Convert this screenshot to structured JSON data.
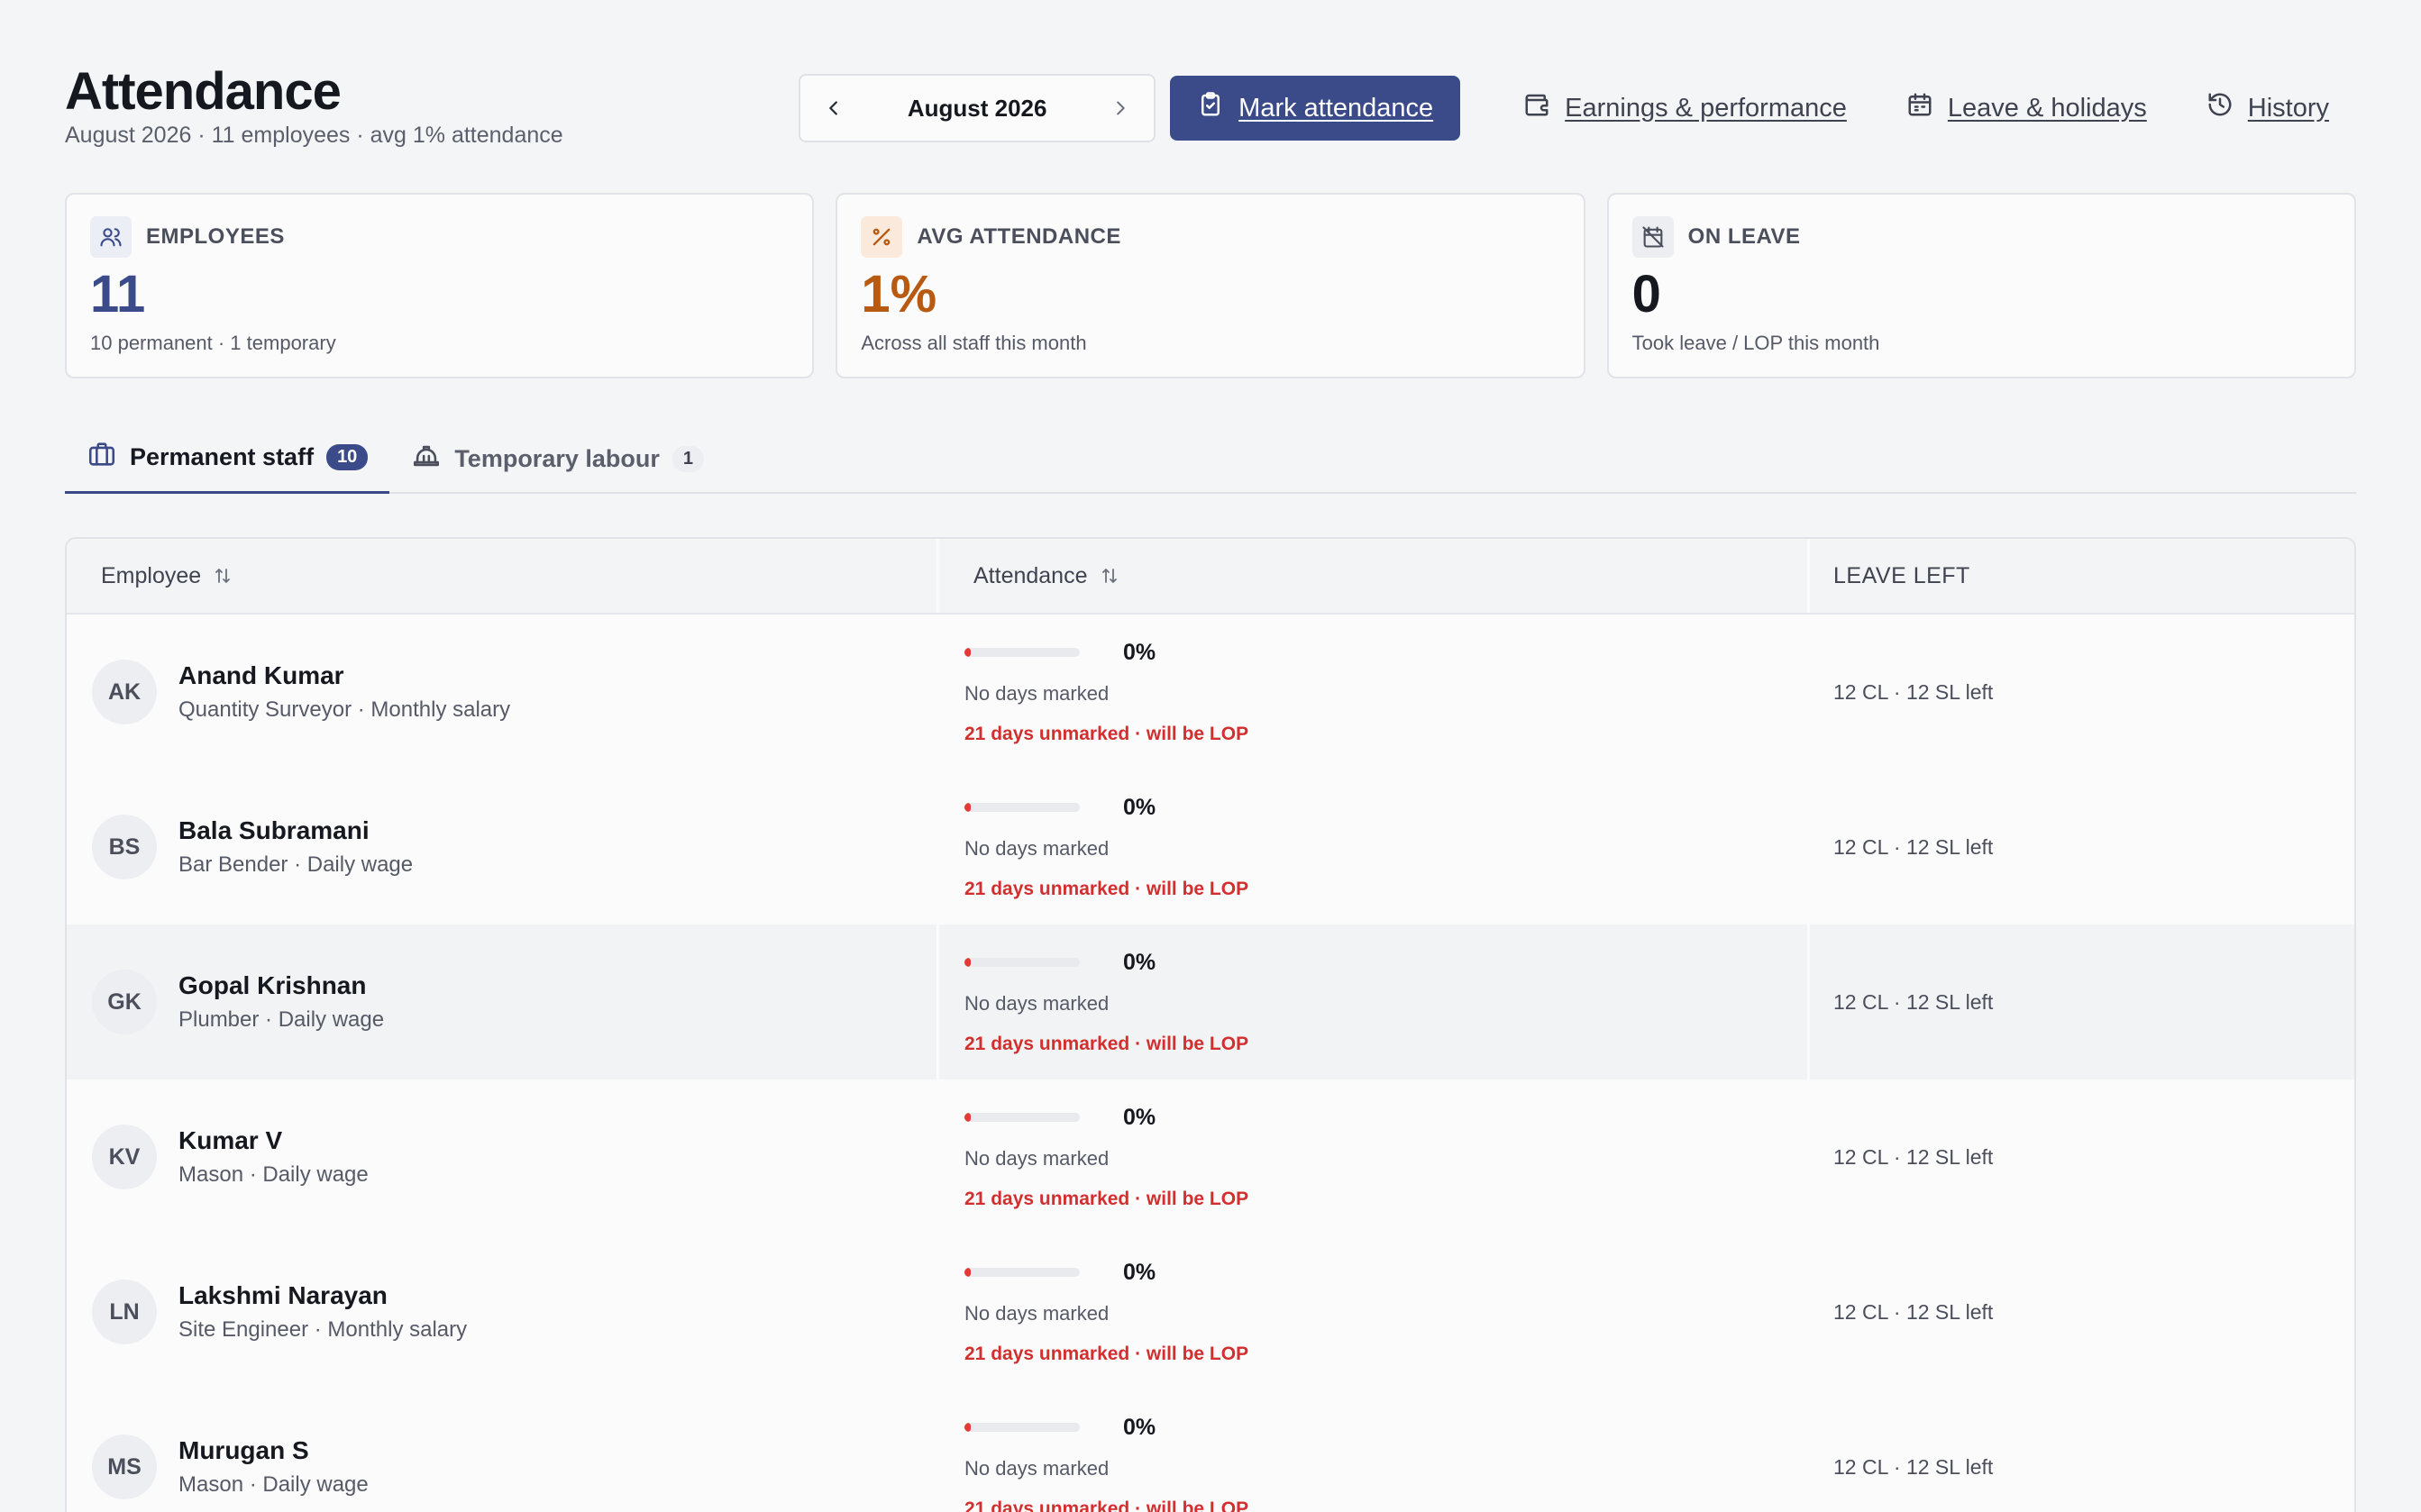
{
  "header": {
    "title": "Attendance",
    "subtitle": "August 2026 · 11 employees · avg 1% attendance"
  },
  "month_picker": {
    "label": "August 2026",
    "prev_icon": "chevron-left-icon",
    "next_icon": "chevron-right-icon"
  },
  "actions": {
    "mark_attendance": "Mark attendance",
    "earnings": "Earnings & performance",
    "leave": "Leave & holidays",
    "history": "History"
  },
  "cards": [
    {
      "label": "EMPLOYEES",
      "value": "11",
      "note": "10 permanent · 1 temporary",
      "icon": "users-icon",
      "value_color": "#3b4b8a",
      "icon_bg": "#eceef6",
      "icon_color": "#3b4b8a"
    },
    {
      "label": "AVG ATTENDANCE",
      "value": "1%",
      "note": "Across all staff this month",
      "icon": "percent-icon",
      "value_color": "#b85a12",
      "icon_bg": "#fbeadb",
      "icon_color": "#b85a12"
    },
    {
      "label": "ON LEAVE",
      "value": "0",
      "note": "Took leave / LOP this month",
      "icon": "calendar-off-icon",
      "value_color": "#15181f",
      "icon_bg": "#eceef2",
      "icon_color": "#4b4f5b"
    }
  ],
  "tabs": [
    {
      "label": "Permanent staff",
      "count": "10",
      "icon": "briefcase-icon",
      "active": true
    },
    {
      "label": "Temporary labour",
      "count": "1",
      "icon": "hard-hat-icon",
      "active": false
    }
  ],
  "table": {
    "columns": [
      "Employee",
      "Attendance",
      "LEAVE LEFT"
    ],
    "rows": [
      {
        "initials": "AK",
        "name": "Anand Kumar",
        "role": "Quantity Surveyor · Monthly salary",
        "attendance_pct": 0,
        "pct_label": "0%",
        "status": "No days marked",
        "warning": "21 days unmarked · will be LOP",
        "leave": "12 CL · 12 SL left"
      },
      {
        "initials": "BS",
        "name": "Bala Subramani",
        "role": "Bar Bender · Daily wage",
        "attendance_pct": 0,
        "pct_label": "0%",
        "status": "No days marked",
        "warning": "21 days unmarked · will be LOP",
        "leave": "12 CL · 12 SL left"
      },
      {
        "initials": "GK",
        "name": "Gopal Krishnan",
        "role": "Plumber · Daily wage",
        "attendance_pct": 0,
        "pct_label": "0%",
        "status": "No days marked",
        "warning": "21 days unmarked · will be LOP",
        "leave": "12 CL · 12 SL left",
        "hover": true
      },
      {
        "initials": "KV",
        "name": "Kumar V",
        "role": "Mason · Daily wage",
        "attendance_pct": 0,
        "pct_label": "0%",
        "status": "No days marked",
        "warning": "21 days unmarked · will be LOP",
        "leave": "12 CL · 12 SL left"
      },
      {
        "initials": "LN",
        "name": "Lakshmi Narayan",
        "role": "Site Engineer · Monthly salary",
        "attendance_pct": 0,
        "pct_label": "0%",
        "status": "No days marked",
        "warning": "21 days unmarked · will be LOP",
        "leave": "12 CL · 12 SL left"
      },
      {
        "initials": "MS",
        "name": "Murugan S",
        "role": "Mason · Daily wage",
        "attendance_pct": 0,
        "pct_label": "0%",
        "status": "No days marked",
        "warning": "21 days unmarked · will be LOP",
        "leave": "12 CL · 12 SL left"
      }
    ]
  }
}
